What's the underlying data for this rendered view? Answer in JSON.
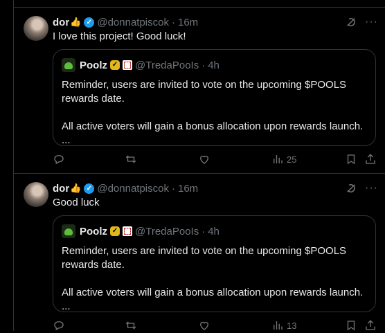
{
  "posts": [
    {
      "author_name": "dor",
      "author_emoji": "👍",
      "handle": "@donnatpiscok",
      "time": "16m",
      "text": "I love this project! Good luck!",
      "quote": {
        "name": "Poolz",
        "handle": "@TredaPooIs",
        "time": "4h",
        "text": "Reminder, users are invited to vote on the upcoming $POOLS rewards date.\n\nAll active voters will gain a bonus allocation upon rewards launch.\n..."
      },
      "views": "25"
    },
    {
      "author_name": "dor",
      "author_emoji": "👍",
      "handle": "@donnatpiscok",
      "time": "16m",
      "text": "Good luck",
      "quote": {
        "name": "Poolz",
        "handle": "@TredaPooIs",
        "time": "4h",
        "text": "Reminder, users are invited to vote on the upcoming $POOLS rewards date.\n\nAll active voters will gain a bonus allocation upon rewards launch.\n..."
      },
      "views": "13"
    }
  ],
  "colors": {
    "background": "#000000",
    "text": "#e7e9ea",
    "muted": "#71767b",
    "border": "#2f3336",
    "verified": "#1d9bf0",
    "gold": "#e2b719"
  },
  "icons": [
    "reply-icon",
    "repost-icon",
    "like-icon",
    "views-icon",
    "bookmark-icon",
    "share-icon",
    "grok-icon",
    "more-icon"
  ]
}
